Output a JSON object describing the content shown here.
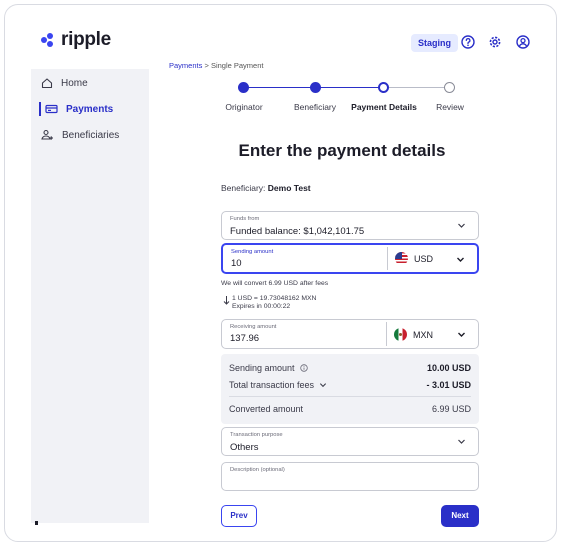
{
  "header": {
    "logo_text": "ripple",
    "environment_badge": "Staging",
    "icons": [
      "help-icon",
      "settings-icon",
      "profile-icon"
    ],
    "accent_color": "#2a2fc8"
  },
  "sidebar": {
    "items": [
      {
        "label": "Home",
        "icon": "home-icon",
        "active": false
      },
      {
        "label": "Payments",
        "icon": "payments-icon",
        "active": true
      },
      {
        "label": "Beneficiaries",
        "icon": "beneficiaries-icon",
        "active": false
      }
    ]
  },
  "breadcrumb": {
    "parent": "Payments",
    "separator": ">",
    "current": "Single Payment"
  },
  "stepper": {
    "steps": [
      {
        "label": "Originator",
        "state": "done"
      },
      {
        "label": "Beneficiary",
        "state": "done"
      },
      {
        "label": "Payment Details",
        "state": "current"
      },
      {
        "label": "Review",
        "state": "todo"
      }
    ]
  },
  "page": {
    "title": "Enter the payment details",
    "beneficiary_label": "Beneficiary:",
    "beneficiary_name": "Demo Test"
  },
  "funds_from": {
    "label": "Funds from",
    "value": "Funded balance: $1,042,101.75"
  },
  "sending_amount": {
    "label": "Sending amount",
    "value": "10",
    "currency": "USD"
  },
  "conversion": {
    "note": "We will convert 6.99 USD after fees",
    "rate": "1 USD = 19.73048162 MXN",
    "expires": "Expires in 00:00:22"
  },
  "receiving_amount": {
    "label": "Receiving amount",
    "value": "137.96",
    "currency": "MXN"
  },
  "summary": {
    "sending_label": "Sending amount",
    "sending_value": "10.00 USD",
    "fees_label": "Total transaction fees",
    "fees_value": "- 3.01 USD",
    "converted_label": "Converted amount",
    "converted_value": "6.99 USD"
  },
  "transaction_purpose": {
    "label": "Transaction purpose",
    "value": "Others"
  },
  "description": {
    "label": "Description (optional)",
    "value": ""
  },
  "actions": {
    "prev_label": "Prev",
    "next_label": "Next"
  }
}
